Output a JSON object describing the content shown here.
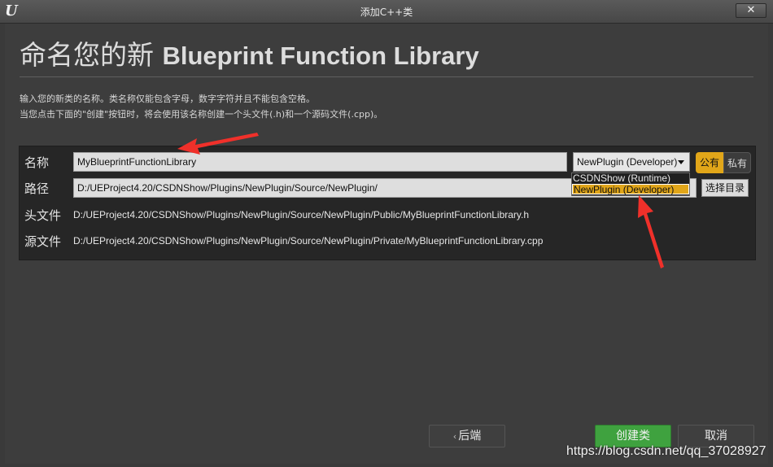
{
  "window": {
    "title": "添加C++类",
    "close_label": "✕",
    "logo": "unreal-engine-logo"
  },
  "header": {
    "prefix": "命名您的新 ",
    "class_type": "Blueprint Function Library"
  },
  "description": {
    "line1": "输入您的新类的名称。类名称仅能包含字母，数字字符并且不能包含空格。",
    "line2": "当您点击下面的\"创建\"按钮时，将会使用该名称创建一个头文件(.h)和一个源码文件(.cpp)。"
  },
  "form": {
    "name_label": "名称",
    "name_value": "MyBlueprintFunctionLibrary",
    "path_label": "路径",
    "path_value": "D:/UEProject4.20/CSDNShow/Plugins/NewPlugin/Source/NewPlugin/",
    "header_label": "头文件",
    "header_value": "D:/UEProject4.20/CSDNShow/Plugins/NewPlugin/Source/NewPlugin/Public/MyBlueprintFunctionLibrary.h",
    "source_label": "源文件",
    "source_value": "D:/UEProject4.20/CSDNShow/Plugins/NewPlugin/Source/NewPlugin/Private/MyBlueprintFunctionLibrary.cpp",
    "module_selected": "NewPlugin (Developer)",
    "module_options": [
      "CSDNShow (Runtime)",
      "NewPlugin (Developer)"
    ],
    "public_label": "公有",
    "private_label": "私有",
    "choose_dir_label": "选择目录"
  },
  "footer": {
    "back_label": "后端",
    "create_label": "创建类",
    "cancel_label": "取消"
  },
  "watermark": "https://blog.csdn.net/qq_37028927",
  "colors": {
    "accent": "#e1a619",
    "create": "#3fa23f",
    "annotation_arrow": "#f0302a"
  }
}
